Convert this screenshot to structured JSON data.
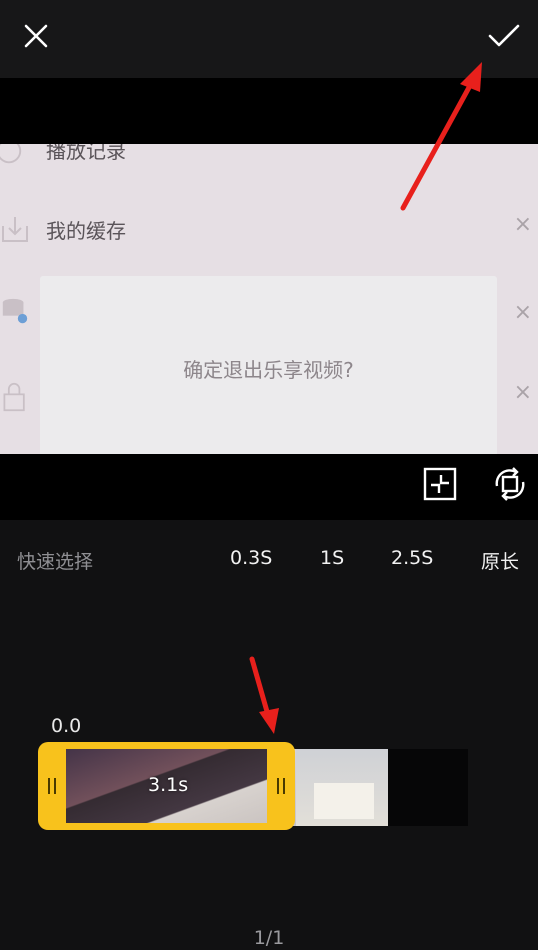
{
  "preview": {
    "rows": [
      {
        "label": "播放记录"
      },
      {
        "label": "我的缓存"
      }
    ],
    "dialog_text": "确定退出乐享视频?"
  },
  "quick_select": {
    "label": "快速选择",
    "options": [
      "0.3S",
      "1S",
      "2.5S",
      "原长"
    ]
  },
  "timeline": {
    "start_time": "0.0",
    "selected_duration": "3.1s"
  },
  "footer": {
    "page_indicator": "1/1"
  },
  "colors": {
    "selection": "#f8c21c",
    "annotation": "#e8201c"
  },
  "icons": [
    "close-icon",
    "check-icon",
    "fit-frame-icon",
    "rotate-icon"
  ]
}
